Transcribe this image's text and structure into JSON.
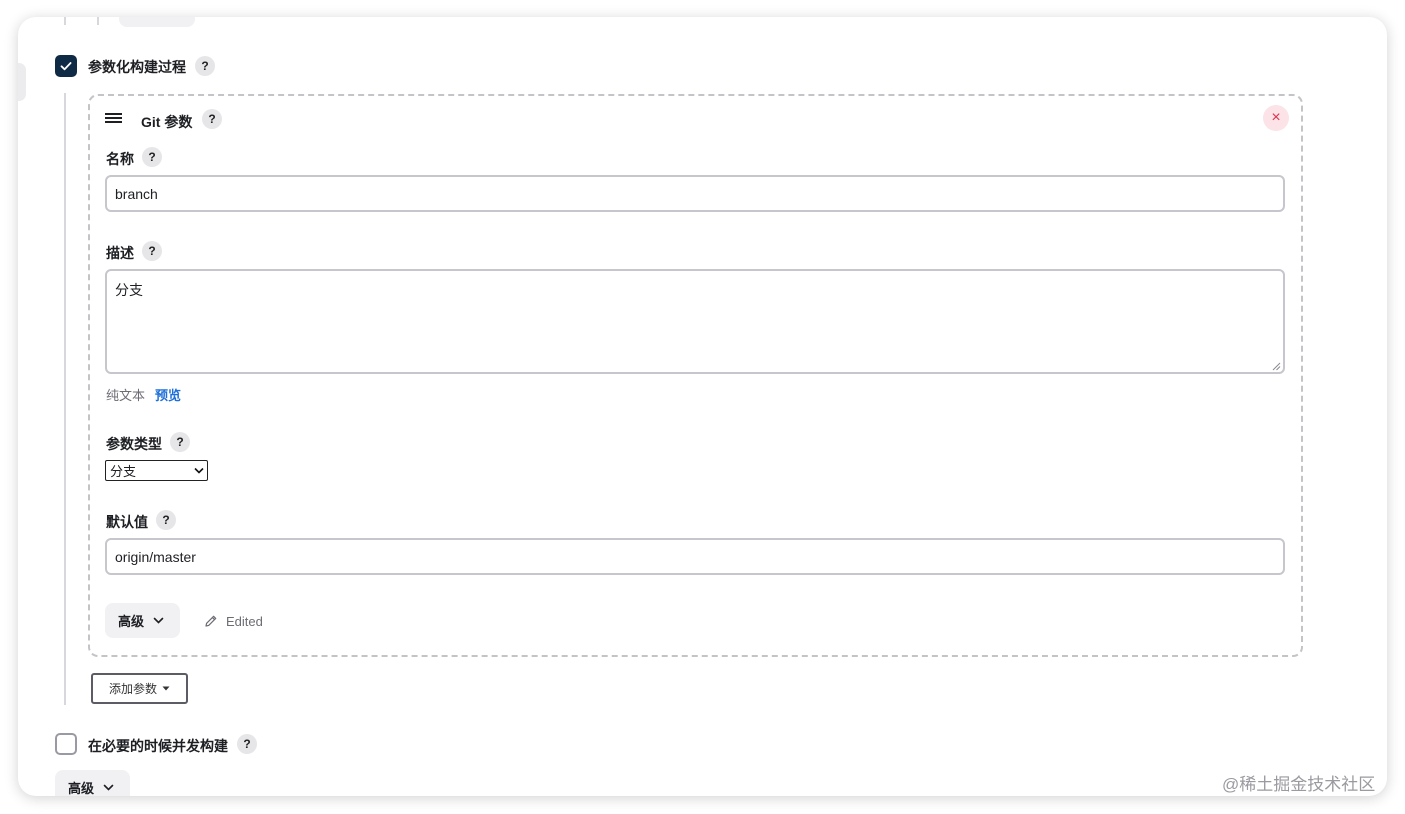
{
  "parameterized": {
    "checkbox_checked": true,
    "label": "参数化构建过程",
    "help": "?"
  },
  "param_card": {
    "handle_icon": "drag-handle-icon",
    "title": "Git 参数",
    "help": "?",
    "close_icon": "close-icon",
    "close_glyph": "×",
    "name": {
      "label": "名称",
      "help": "?",
      "value": "branch"
    },
    "description": {
      "label": "描述",
      "help": "?",
      "value": "分支",
      "plain_text": "纯文本",
      "preview": "预览"
    },
    "param_type": {
      "label": "参数类型",
      "help": "?",
      "selected": "分支"
    },
    "default_value": {
      "label": "默认值",
      "help": "?",
      "value": "origin/master"
    },
    "advanced": {
      "label": "高级",
      "icon": "chevron-down-icon"
    },
    "edited": {
      "icon": "pencil-icon",
      "label": "Edited"
    }
  },
  "add_param": {
    "label": "添加参数"
  },
  "concurrent": {
    "checkbox_checked": false,
    "label": "在必要的时候并发构建",
    "help": "?"
  },
  "bottom_advanced": {
    "label": "高级",
    "icon": "chevron-down-icon"
  },
  "watermark": "@稀土掘金技术社区",
  "colors": {
    "checkbox_checked_bg": "#0f2a44",
    "link_blue": "#1e6fd9",
    "close_bg": "#fbe3e7",
    "close_fg": "#e0334f"
  }
}
